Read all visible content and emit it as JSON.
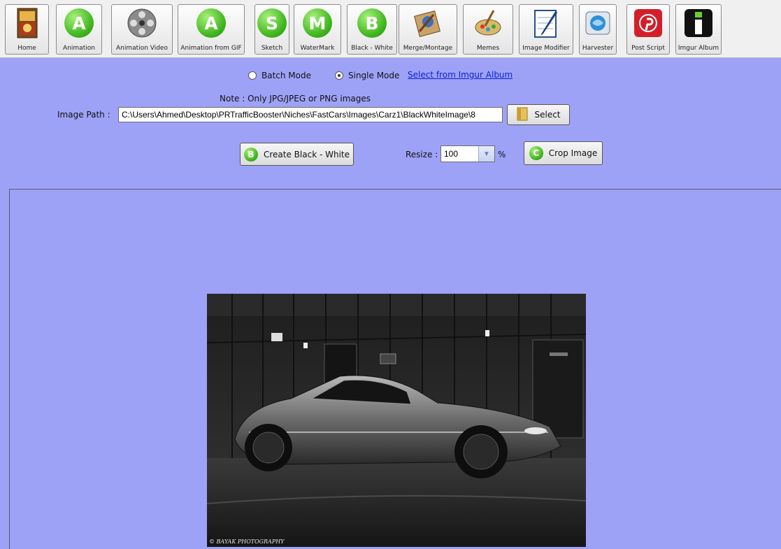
{
  "toolbar": {
    "buttons": [
      {
        "label": "Home",
        "icon": "home-icon"
      },
      {
        "label": "Animation",
        "icon": "animation-icon",
        "letter": "A"
      },
      {
        "label": "Animation Video",
        "icon": "film-reel-icon"
      },
      {
        "label": "Animation from GIF",
        "icon": "animation-gif-icon",
        "letter": "A"
      },
      {
        "label": "Sketch",
        "icon": "sketch-icon",
        "letter": "S"
      },
      {
        "label": "WaterMark",
        "icon": "watermark-icon",
        "letter": "M"
      },
      {
        "label": "Black - White",
        "icon": "black-white-icon",
        "letter": "B"
      },
      {
        "label": "Merge/Montage",
        "icon": "merge-icon"
      },
      {
        "label": "Memes",
        "icon": "memes-icon"
      },
      {
        "label": "Image Modifier",
        "icon": "notepad-pen-icon"
      },
      {
        "label": "Harvester",
        "icon": "harvester-icon"
      },
      {
        "label": "Post Script",
        "icon": "pinterest-icon"
      },
      {
        "label": "Imgur Album",
        "icon": "imgur-icon"
      }
    ]
  },
  "mode": {
    "batch_label": "Batch Mode",
    "single_label": "Single Mode",
    "selected": "Single Mode",
    "imgur_link": "Select from Imgur Album"
  },
  "note": "Note : Only JPG/JPEG or PNG images",
  "image_path": {
    "label": "Image Path :",
    "value": "C:\\Users\\Ahmed\\Desktop\\PRTrafficBooster\\Niches\\FastCars\\Images\\Carz1\\BlackWhiteImage\\8",
    "select_label": "Select"
  },
  "actions": {
    "create_label": "Create Black - White",
    "create_icon_letter": "B",
    "resize_label": "Resize :",
    "resize_value": "100",
    "resize_unit": "%",
    "crop_label": "Crop Image",
    "crop_icon_letter": "C"
  },
  "preview": {
    "watermark": "© BAYAK PHOTOGRAPHY"
  },
  "colors": {
    "background": "#9ea2f7",
    "icon_green": "#3fb51e",
    "link": "#0a1fd6"
  }
}
